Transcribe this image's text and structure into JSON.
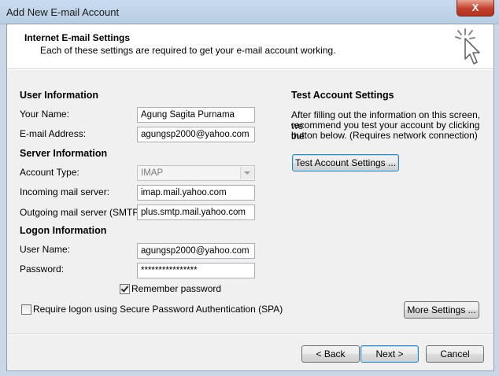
{
  "window": {
    "title": "Add New E-mail Account",
    "close_glyph": "X"
  },
  "header": {
    "title": "Internet E-mail Settings",
    "subtitle": "Each of these settings are required to get your e-mail account working.",
    "icon": "cursor-click-icon"
  },
  "user_info": {
    "heading": "User Information",
    "name_label": "Your Name:",
    "name_value": "Agung Sagita Purnama",
    "email_label": "E-mail Address:",
    "email_value": "agungsp2000@yahoo.com"
  },
  "server_info": {
    "heading": "Server Information",
    "account_type_label": "Account Type:",
    "account_type_value": "IMAP",
    "incoming_label": "Incoming mail server:",
    "incoming_value": "imap.mail.yahoo.com",
    "outgoing_label": "Outgoing mail server (SMTP):",
    "outgoing_value": "plus.smtp.mail.yahoo.com"
  },
  "logon_info": {
    "heading": "Logon Information",
    "username_label": "User Name:",
    "username_value": "agungsp2000@yahoo.com",
    "password_label": "Password:",
    "password_value": "****************",
    "remember_label": "Remember password",
    "remember_checked": true,
    "spa_label": "Require logon using Secure Password Authentication (SPA)",
    "spa_checked": false
  },
  "test_settings": {
    "heading": "Test Account Settings",
    "description_line1": "After filling out the information on this screen, we",
    "description_line2": "recommend you test your account by clicking the",
    "description_line3": "button below. (Requires network connection)",
    "button_label": "Test Account Settings ..."
  },
  "more_settings_label": "More Settings ...",
  "footer": {
    "back_label": "< Back",
    "next_label": "Next >",
    "cancel_label": "Cancel"
  },
  "colors": {
    "title_bar": "#c9dbef",
    "close_button": "#c2402b",
    "dialog_bg": "#f0f0f0",
    "focus_border": "#3c7fb1"
  }
}
